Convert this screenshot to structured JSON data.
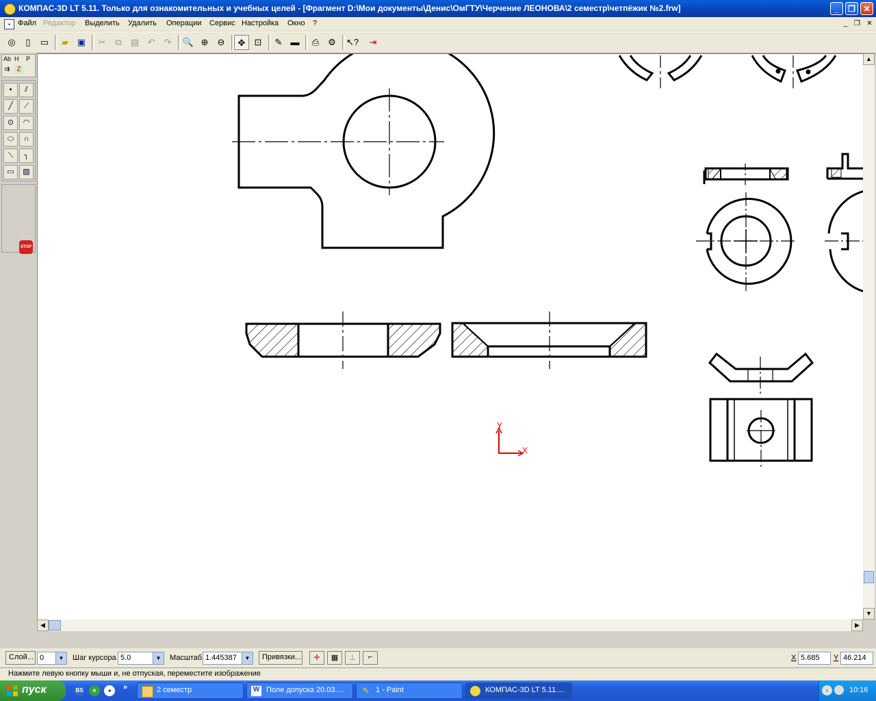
{
  "window": {
    "title": "КОМПАС-3D LT 5.11. Только для ознакомительных и учебных целей - [Фрагмент D:\\Мои документы\\Денис\\ОмГТУ\\Черчение ЛЕОНОВА\\2 семестр\\четпёжик №2.frw]",
    "controls": {
      "minimize": "_",
      "restore": "❐",
      "close": "✕"
    }
  },
  "menu": {
    "items": [
      "Файл",
      "Редактор",
      "Выделить",
      "Удалить",
      "Операции",
      "Сервис",
      "Настройка",
      "Окно",
      "?"
    ],
    "disabled": [
      "Редактор"
    ]
  },
  "toolbar": {
    "icons": [
      "new-document-icon",
      "new-fragment-icon",
      "open-icon",
      "save-icon",
      "cut-icon",
      "copy-icon",
      "paste-icon",
      "undo-icon",
      "redo-icon",
      "zoom-icon",
      "zoom-in-icon",
      "zoom-out-icon",
      "pan-icon",
      "zoom-frame-icon",
      "properties-icon",
      "view-manager-icon",
      "print-preview-icon",
      "calculator-icon",
      "help-cursor-icon",
      "exit-icon"
    ]
  },
  "left_panel": {
    "tabs": [
      "Ab",
      "H",
      "P"
    ],
    "tools": [
      "point",
      "auxiliary-line",
      "segment",
      "parallel-line",
      "circle",
      "arc",
      "ellipse",
      "bezier",
      "chamfer",
      "fillet",
      "rectangle",
      "hatch"
    ],
    "stop_label": "STOP"
  },
  "canvas": {
    "axis_x": "X",
    "axis_y": "Y",
    "axis_color": "#e00000"
  },
  "status": {
    "layer_label": "Слой...",
    "layer_value": "0",
    "step_label": "Шаг курсора",
    "step_value": "5.0",
    "scale_label": "Масштаб",
    "scale_value": "1.445387",
    "snaps_label": "Привязки...",
    "x_label": "X",
    "x_value": "5.685",
    "y_label": "Y",
    "y_value": "46.214",
    "hint": "Нажмите левую кнопку мыши и, не отпуская, переместите изображение"
  },
  "taskbar": {
    "start": "пуск",
    "tasks": [
      "2 семестр",
      "Поле допуска 20.03....",
      "1 - Paint",
      "КОМПАС-3D LT 5.11...."
    ],
    "active_task": "КОМПАС-3D LT 5.11....",
    "chevron": "»",
    "clock": "10:16"
  }
}
